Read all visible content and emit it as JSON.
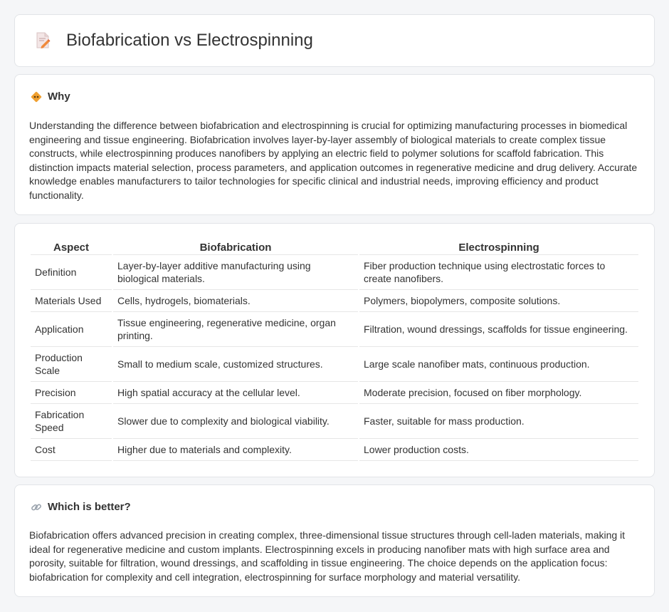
{
  "header": {
    "title": "Biofabrication vs Electrospinning",
    "icon": "document-pencil-icon"
  },
  "why": {
    "title": "Why",
    "icon": "diamond-sign-icon",
    "text": "Understanding the difference between biofabrication and electrospinning is crucial for optimizing manufacturing processes in biomedical engineering and tissue engineering. Biofabrication involves layer-by-layer assembly of biological materials to create complex tissue constructs, while electrospinning produces nanofibers by applying an electric field to polymer solutions for scaffold fabrication. This distinction impacts material selection, process parameters, and application outcomes in regenerative medicine and drug delivery. Accurate knowledge enables manufacturers to tailor technologies for specific clinical and industrial needs, improving efficiency and product functionality."
  },
  "table": {
    "headers": [
      "Aspect",
      "Biofabrication",
      "Electrospinning"
    ],
    "rows": [
      [
        "Definition",
        "Layer-by-layer additive manufacturing using biological materials.",
        "Fiber production technique using electrostatic forces to create nanofibers."
      ],
      [
        "Materials Used",
        "Cells, hydrogels, biomaterials.",
        "Polymers, biopolymers, composite solutions."
      ],
      [
        "Application",
        "Tissue engineering, regenerative medicine, organ printing.",
        "Filtration, wound dressings, scaffolds for tissue engineering."
      ],
      [
        "Production Scale",
        "Small to medium scale, customized structures.",
        "Large scale nanofiber mats, continuous production."
      ],
      [
        "Precision",
        "High spatial accuracy at the cellular level.",
        "Moderate precision, focused on fiber morphology."
      ],
      [
        "Fabrication Speed",
        "Slower due to complexity and biological viability.",
        "Faster, suitable for mass production."
      ],
      [
        "Cost",
        "Higher due to materials and complexity.",
        "Lower production costs."
      ]
    ]
  },
  "better": {
    "title": "Which is better?",
    "icon": "link-icon",
    "text": "Biofabrication offers advanced precision in creating complex, three-dimensional tissue structures through cell-laden materials, making it ideal for regenerative medicine and custom implants. Electrospinning excels in producing nanofiber mats with high surface area and porosity, suitable for filtration, wound dressings, and scaffolding in tissue engineering. The choice depends on the application focus: biofabrication for complexity and cell integration, electrospinning for surface morphology and material versatility."
  },
  "colors": {
    "background": "#f5f6f8",
    "card": "#ffffff",
    "border": "#e2e4e8",
    "text": "#333333",
    "accent_orange": "#f0a030"
  }
}
